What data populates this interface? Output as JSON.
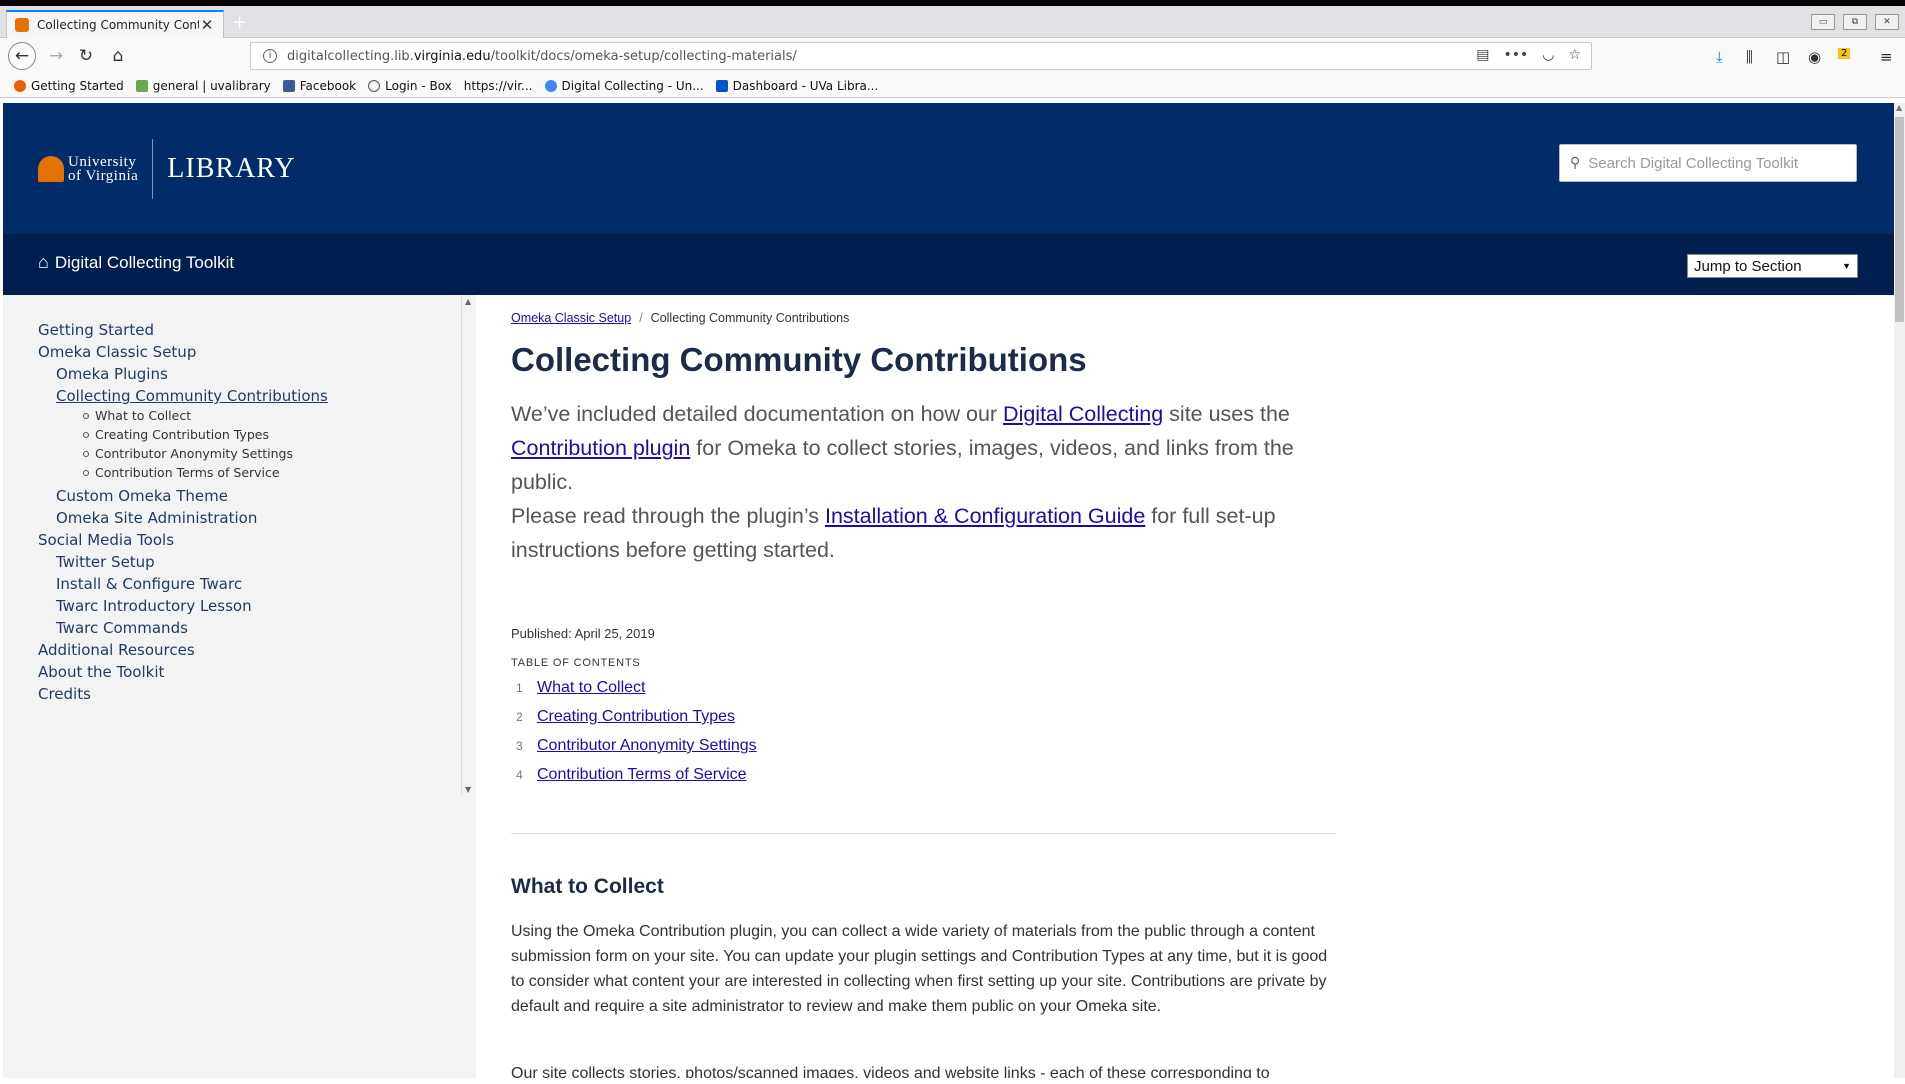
{
  "browser": {
    "tab_title": "Collecting Community Contrib",
    "url_prefix": "digitalcollecting.lib.",
    "url_domain": "virginia.edu",
    "url_path": "/toolkit/docs/omeka-setup/collecting-materials/",
    "download_badge": "2",
    "bookmarks": [
      {
        "label": "Getting Started",
        "color": "#e66000"
      },
      {
        "label": "general | uvalibrary",
        "color": "#6aa84f"
      },
      {
        "label": "Facebook",
        "color": "#3b5998"
      },
      {
        "label": "Login - Box",
        "color": "#555555"
      },
      {
        "label": "https://vir...",
        "color": ""
      },
      {
        "label": "Digital Collecting - Un...",
        "color": "#4285f4"
      },
      {
        "label": "Dashboard - UVa Libra...",
        "color": "#0052cc"
      }
    ]
  },
  "header": {
    "university_line1": "University",
    "university_line2": "of Virginia",
    "library": "LIBRARY",
    "search_placeholder": "Search Digital Collecting Toolkit"
  },
  "subnav": {
    "home_label": "Digital Collecting Toolkit",
    "jump_label": "Jump to Section"
  },
  "sidebar": {
    "items": [
      "Getting Started",
      "Omeka Classic Setup",
      "Omeka Plugins",
      "Collecting Community Contributions",
      "Custom Omeka Theme",
      "Omeka Site Administration",
      "Social Media Tools",
      "Twitter Setup",
      "Install & Configure Twarc",
      "Twarc Introductory Lesson",
      "Twarc Commands",
      "Additional Resources",
      "About the Toolkit",
      "Credits"
    ],
    "subitems": [
      "What to Collect",
      "Creating Contribution Types",
      "Contributor Anonymity Settings",
      "Contribution Terms of Service"
    ]
  },
  "content": {
    "breadcrumb_parent": "Omeka Classic Setup",
    "breadcrumb_sep": "/",
    "breadcrumb_current": "Collecting Community Contributions",
    "title": "Collecting Community Contributions",
    "lead1_a": "We’ve included detailed documentation on how our ",
    "lead1_link1": "Digital Collecting",
    "lead1_b": " site uses the ",
    "lead1_link2": "Contribution plugin",
    "lead1_c": " for Omeka to collect stories, images, videos, and links from the public.",
    "lead2_a": "Please read through the plugin’s ",
    "lead2_link": "Installation & Configuration Guide",
    "lead2_b": " for full set-up instructions before getting started.",
    "published": "Published: April 25, 2019",
    "toc_label": "TABLE OF CONTENTS",
    "toc": [
      {
        "num": "1",
        "label": "What to Collect"
      },
      {
        "num": "2",
        "label": "Creating Contribution Types"
      },
      {
        "num": "3",
        "label": "Contributor Anonymity Settings"
      },
      {
        "num": "4",
        "label": "Contribution Terms of Service"
      }
    ],
    "section_heading": "What to Collect",
    "section_body": "Using the Omeka Contribution plugin, you can collect a wide variety of materials from the public through a content submission form on your site. You can update your plugin settings and Contribution Types at any time, but it is good to consider what content your are interested in collecting when first setting up your site. Contributions are private by default and require a site administrator to review and make them public on your Omeka site.",
    "section_body2": "Our site collects stories, photos/scanned images, videos and website links - each of these corresponding to"
  }
}
